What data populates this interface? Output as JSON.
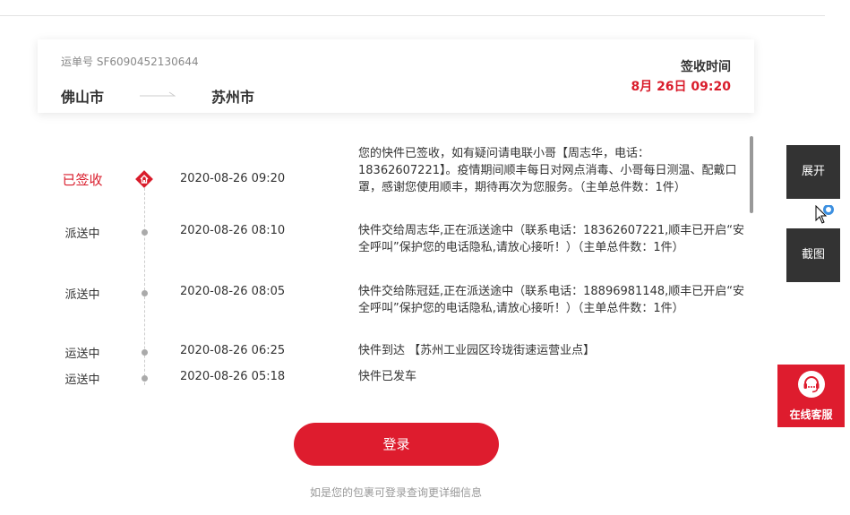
{
  "waybill": {
    "label": "运单号",
    "number": "SF6090452130644"
  },
  "route": {
    "from": "佛山市",
    "to": "苏州市"
  },
  "sign": {
    "label": "签收时间",
    "time": "8月 26日 09:20"
  },
  "tracking": [
    {
      "status": "已签收",
      "time": "2020-08-26 09:20",
      "desc": "您的快件已签收，如有疑问请电联小哥【周志华，电话：18362607221】。疫情期间顺丰每日对网点消毒、小哥每日测温、配戴口罩，感谢您使用顺丰，期待再次为您服务。（主单总件数：1件）"
    },
    {
      "status": "派送中",
      "time": "2020-08-26 08:10",
      "desc": "快件交给周志华,正在派送途中（联系电话：18362607221,顺丰已开启“安全呼叫”保护您的电话隐私,请放心接听！）（主单总件数：1件）"
    },
    {
      "status": "派送中",
      "time": "2020-08-26 08:05",
      "desc": "快件交给陈冠廷,正在派送途中（联系电话：18896981148,顺丰已开启“安全呼叫”保护您的电话隐私,请放心接听！）（主单总件数：1件）"
    },
    {
      "status": "运送中",
      "time": "2020-08-26 06:25",
      "desc": "快件到达 【苏州工业园区玲珑街速运营业点】"
    },
    {
      "status": "运送中",
      "time": "2020-08-26 05:18",
      "desc": "快件已发车"
    }
  ],
  "login": {
    "label": "登录",
    "hint": "如是您的包裹可登录查询更详细信息"
  },
  "side": {
    "expand": "展开",
    "screenshot": "截图",
    "service": "在线客服"
  },
  "icons": {
    "signed": "home-icon",
    "service": "headset-icon",
    "cursor": "mouse-pointer-icon"
  },
  "colors": {
    "accent": "#de1c2e",
    "status_signed": "#d91c2b",
    "side_button": "#333333"
  }
}
